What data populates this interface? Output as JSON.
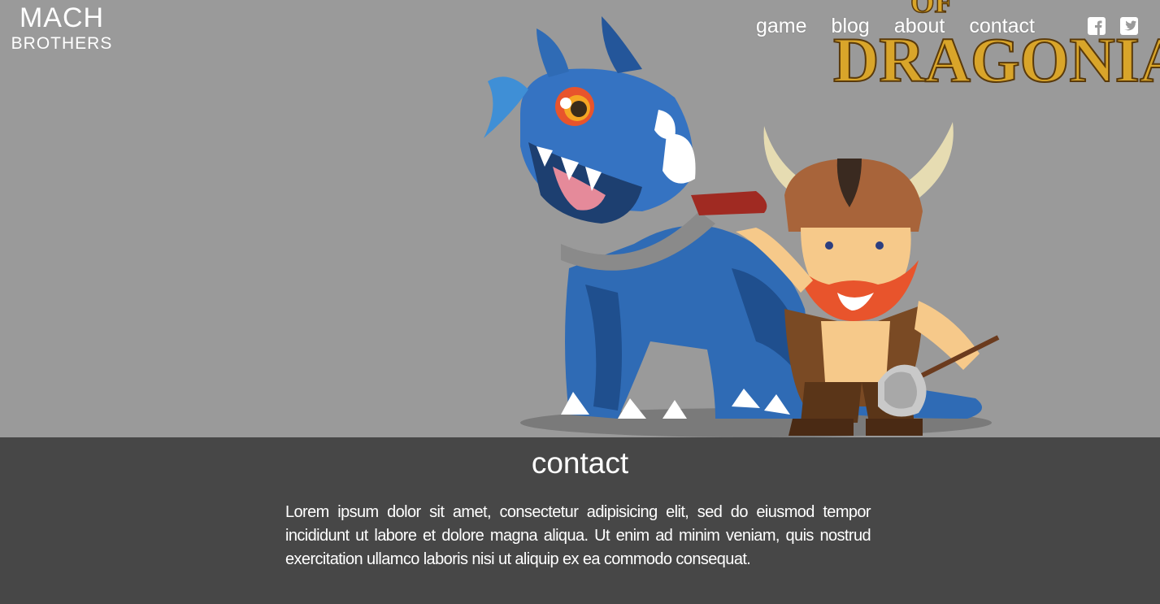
{
  "brand": {
    "logo_top": "MACH",
    "logo_bottom": "BROTHERS"
  },
  "hero": {
    "game_logo_top": "OF",
    "game_logo_bottom": "DRAGONIA"
  },
  "nav": {
    "items": [
      {
        "label": "game"
      },
      {
        "label": "blog"
      },
      {
        "label": "about"
      },
      {
        "label": "contact"
      }
    ]
  },
  "social": {
    "icons": [
      "facebook-icon",
      "twitter-icon"
    ]
  },
  "content": {
    "title": "contact",
    "body": "Lorem ipsum dolor sit amet, consectetur adipisicing elit, sed do eiusmod tempor incididunt ut labore et dolore magna aliqua. Ut enim ad minim veniam, quis nostrud exercitation ullamco laboris nisi ut aliquip ex ea commodo consequat."
  },
  "colors": {
    "hero_bg": "#9a9a9a",
    "content_bg": "#474747",
    "dragon_blue": "#2f6bb5",
    "beard_orange": "#e8542c",
    "logo_gold": "#d9a52a"
  }
}
